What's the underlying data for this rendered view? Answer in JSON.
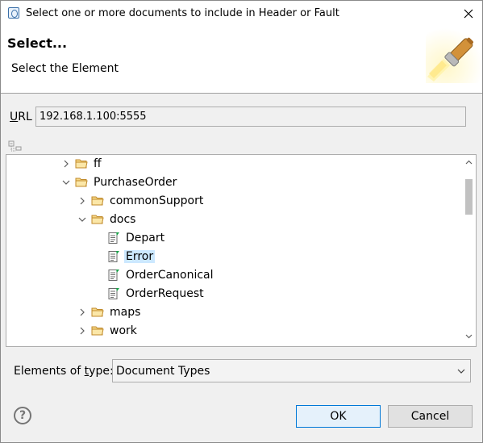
{
  "window": {
    "title": "Select one or more documents to include in Header or Fault"
  },
  "banner": {
    "title": "Select...",
    "message": "Select the Element"
  },
  "url": {
    "label_mnemonic": "U",
    "label_rest": "RL",
    "value": "192.168.1.100:5555"
  },
  "tree": {
    "items": [
      {
        "label": "ff",
        "type": "folder",
        "expanded": false,
        "depth": 0
      },
      {
        "label": "PurchaseOrder",
        "type": "folder",
        "expanded": true,
        "depth": 0
      },
      {
        "label": "commonSupport",
        "type": "folder",
        "expanded": false,
        "depth": 1
      },
      {
        "label": "docs",
        "type": "folder",
        "expanded": true,
        "depth": 1
      },
      {
        "label": "Depart",
        "type": "document",
        "depth": 2
      },
      {
        "label": "Error",
        "type": "document",
        "depth": 2,
        "selected": true
      },
      {
        "label": "OrderCanonical",
        "type": "document",
        "depth": 2
      },
      {
        "label": "OrderRequest",
        "type": "document",
        "depth": 2
      },
      {
        "label": "maps",
        "type": "folder",
        "expanded": false,
        "depth": 1
      },
      {
        "label": "work",
        "type": "folder",
        "expanded": false,
        "depth": 1
      }
    ]
  },
  "type_filter": {
    "label_pre": "Elements of ",
    "label_mnemonic": "t",
    "label_post": "ype:",
    "selected": "Document Types"
  },
  "buttons": {
    "ok": "OK",
    "cancel": "Cancel"
  },
  "colors": {
    "selection": "#cce8ff",
    "default_button_border": "#0078d7",
    "folder": "#e0b050"
  }
}
